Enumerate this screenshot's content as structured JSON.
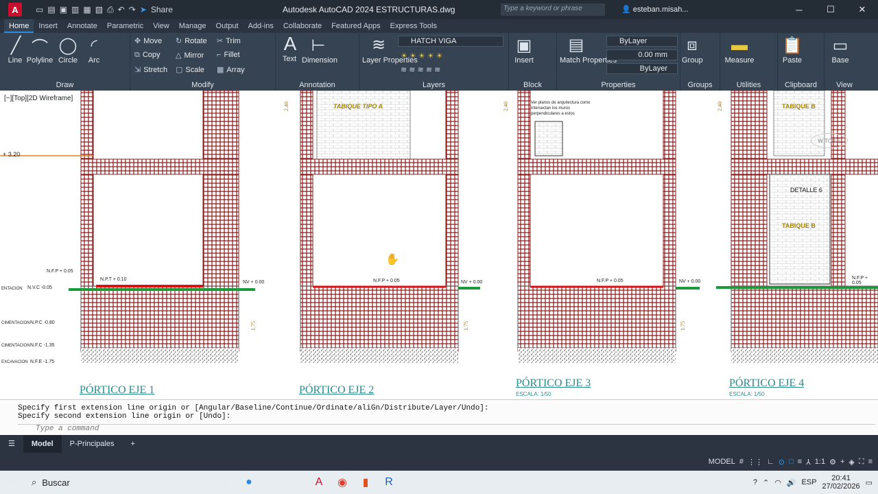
{
  "window": {
    "title": "Autodesk AutoCAD 2024   ESTRUCTURAS.dwg",
    "logo": "A",
    "share_label": "Share",
    "search_placeholder": "Type a keyword or phrase",
    "user": "esteban.misah..."
  },
  "ribbon_tabs": [
    "Home",
    "Insert",
    "Annotate",
    "Parametric",
    "View",
    "Manage",
    "Output",
    "Add-ins",
    "Collaborate",
    "Featured Apps",
    "Express Tools"
  ],
  "ribbon": {
    "draw": {
      "title": "Draw",
      "line": "Line",
      "polyline": "Polyline",
      "circle": "Circle",
      "arc": "Arc"
    },
    "modify": {
      "title": "Modify",
      "move": "Move",
      "rotate": "Rotate",
      "trim": "Trim",
      "copy": "Copy",
      "mirror": "Mirror",
      "fillet": "Fillet",
      "stretch": "Stretch",
      "scale": "Scale",
      "array": "Array"
    },
    "annotation": {
      "title": "Annotation",
      "text": "Text",
      "dimension": "Dimension"
    },
    "layers": {
      "title": "Layers",
      "layer_properties": "Layer Properties",
      "current_layer": "HATCH VIGA"
    },
    "block": {
      "title": "Block",
      "insert": "Insert"
    },
    "properties": {
      "title": "Properties",
      "match": "Match Properties",
      "color": "ByLayer",
      "lineweight": "0.00 mm",
      "linetype": "ByLayer"
    },
    "groups": {
      "title": "Groups",
      "group": "Group"
    },
    "utilities": {
      "title": "Utilities",
      "measure": "Measure"
    },
    "clipboard": {
      "title": "Clipboard",
      "paste": "Paste"
    },
    "view": {
      "title": "View",
      "base": "Base"
    }
  },
  "viewport": {
    "label": "[−][Top][2D Wireframe]",
    "compass_top": "TOP",
    "compass_w": "W",
    "compass_e": "E"
  },
  "drawing": {
    "porticos": [
      {
        "title": "PÓRTICO EJE 1",
        "scale": ""
      },
      {
        "title": "PÓRTICO EJE 2",
        "scale": ""
      },
      {
        "title": "PÓRTICO EJE 3",
        "scale": "ESCALA: 1/50"
      },
      {
        "title": "PÓRTICO EJE 4",
        "scale": "ESCALA: 1/50"
      }
    ],
    "labels": {
      "level_320": "+ 3.20",
      "tabique_a": "TABIQUE TIPO A",
      "tabique_b1": "TABIQUE B",
      "tabique_b2": "TABIQUE B",
      "detalle": "DETALLE 6",
      "note": "Ver planos de arquitectura como intersectan los muros perpendiculares a estos",
      "nfp1": "N.F.P + 0.05",
      "npt1": "N.P.T + 0.10",
      "nvc": "N.V.C -0.05",
      "npc": "N.P.C -0.80",
      "nfc": "N.F.C -1.35",
      "nfe": "N.F.E -1.75",
      "nv1": "NV + 0.00",
      "nfp2": "N.F.P + 0.05",
      "nv2": "NV + 0.00",
      "nfp3": "N.F.P + 0.05",
      "nv3": "NV + 0.00",
      "nfp4": "N.F.P + 0.05",
      "cim1": "ENTACION",
      "cim2": "CIMENTACION",
      "cim3": "CIMENTACION",
      "cim4": "EXCAVACION"
    }
  },
  "command": {
    "line1": "Specify first extension line origin or [Angular/Baseline/Continue/Ordinate/aliGn/Distribute/Layer/Undo]:",
    "line2": "Specify second extension line origin or [Undo]:",
    "placeholder": "Type a command"
  },
  "layout_tabs": {
    "model": "Model",
    "layout1": "P-Principales",
    "add": "+"
  },
  "status": {
    "model": "MODEL",
    "scale": "1:1"
  },
  "taskbar": {
    "search": "Buscar",
    "lang": "ESP",
    "time": "20:41",
    "date": "27/02/2026"
  }
}
